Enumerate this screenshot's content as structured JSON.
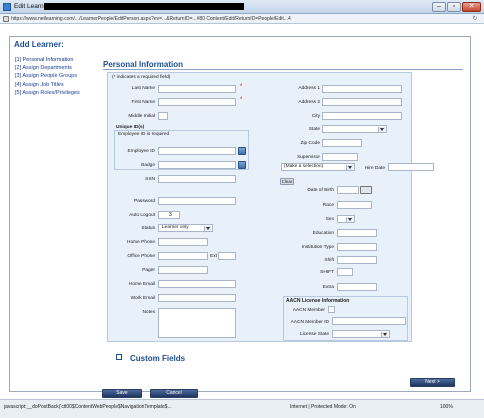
{
  "window": {
    "title": "Edit Learner",
    "minimize": "–",
    "restore": "▫",
    "close": "✕"
  },
  "address": {
    "url": "https://www.netlearning.com/.../LearnerPeople/EditPerson.aspx?ev=...&ReturnID=...#80 Content/Edit/ReturnID=People/Edit...4",
    "refresh": "↻"
  },
  "page": {
    "heading": "Add Learner:",
    "nav": [
      "[1] Personal Information",
      "[2] Assign Departments",
      "[3] Assign People Groups",
      "[4] Assign Job Titles",
      "[5] Assign Roles/Privileges"
    ],
    "section_title": "Personal Information",
    "required_note": "(* indicates a required field)",
    "unique_ids": "Unique ID(s)",
    "employee_id_required": "Employee ID is required",
    "labels": {
      "last_name": "Last Name",
      "first_name": "First Name",
      "middle_initial": "Middle Initial",
      "employee_id": "Employee ID",
      "badge": "Badge",
      "ssn": "SSN",
      "password": "Password",
      "auto_logout": "Auto Logout",
      "status": "Status",
      "home_phone": "Home Phone",
      "office_phone": "Office Phone",
      "ext": "Ext",
      "pager": "Pager",
      "home_email": "Home Email",
      "work_email": "Work Email",
      "notes": "Notes",
      "address1": "Address 1",
      "address2": "Address 2",
      "city": "City",
      "state": "State",
      "zip_code": "Zip Code",
      "supervisor": "Supervisor",
      "hire_date": "Hire Date",
      "date_of_birth": "Date of Birth",
      "race": "Race",
      "sex": "Sex",
      "education": "Education",
      "institution_type": "Institution Type",
      "shift": "Shift",
      "shift2": "SHIFT",
      "extra": "Extra",
      "aacn_title": "AACN License Information",
      "aacn_member": "AACN Member",
      "aacn_member_id": "AACN Member ID",
      "license_state": "License State"
    },
    "values": {
      "auto_logout": "3",
      "status": "Learner only",
      "supervisor_select": "(Make a selection)",
      "clear": "Clear"
    },
    "custom_fields": "Custom Fields",
    "save": "Save",
    "cancel": "Cancel",
    "next": "Next >"
  },
  "status": {
    "url": "javascript:__doPostBack('ctl00$ContentWebPeople$NavigationTemplate$...",
    "zone": "Internet | Protected Mode: On",
    "zoom": "100%"
  }
}
